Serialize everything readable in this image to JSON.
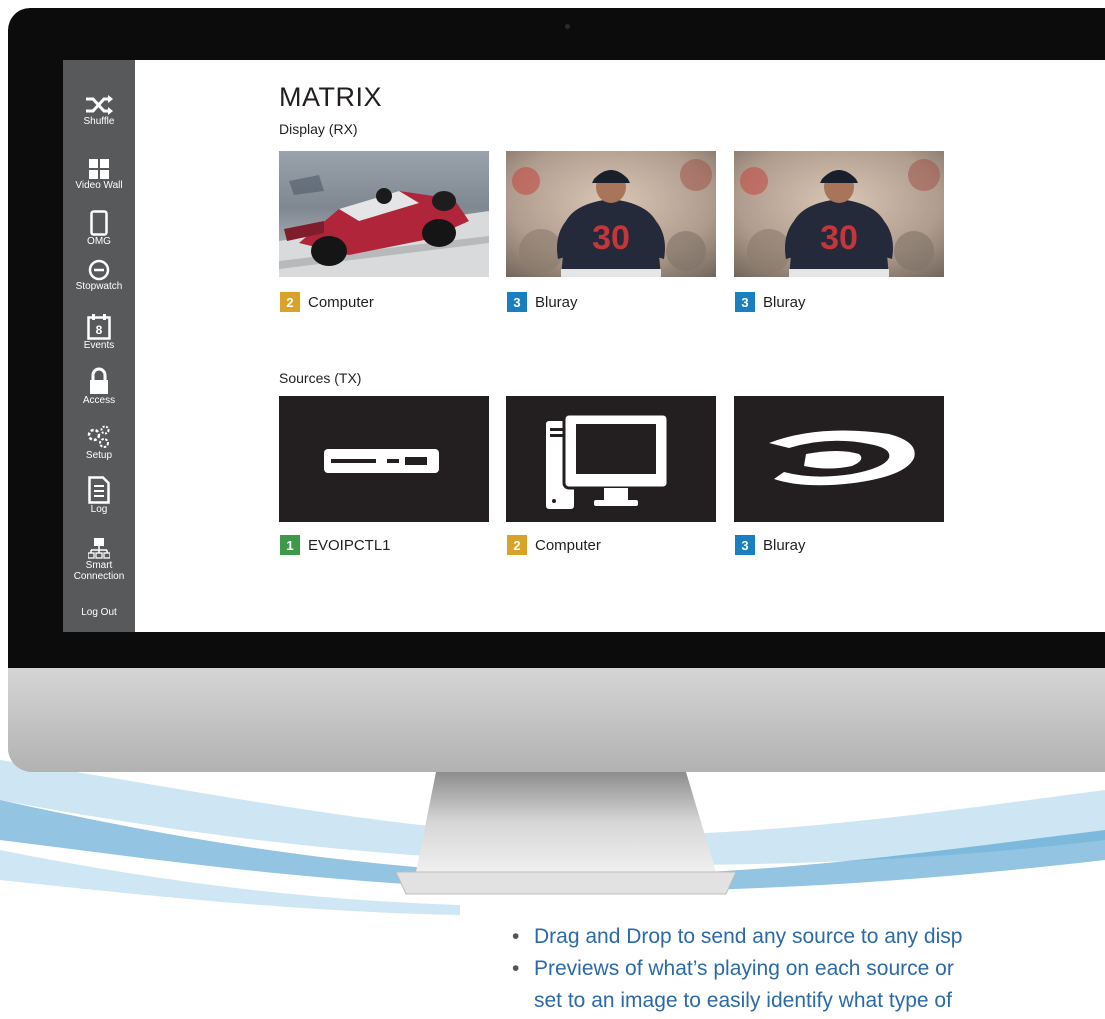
{
  "page": {
    "title": "MATRIX",
    "display_section_label": "Display (RX)",
    "sources_section_label": "Sources (TX)"
  },
  "sidebar": {
    "items": [
      {
        "label": "Shuffle",
        "icon": "shuffle-icon"
      },
      {
        "label": "Video Wall",
        "icon": "grid-icon"
      },
      {
        "label": "OMG",
        "icon": "tablet-icon"
      },
      {
        "label": "Stopwatch",
        "icon": "clock-icon"
      },
      {
        "label": "Events",
        "icon": "calendar-icon",
        "calendar_day": "8"
      },
      {
        "label": "Access",
        "icon": "lock-icon"
      },
      {
        "label": "Setup",
        "icon": "gears-icon"
      },
      {
        "label": "Log",
        "icon": "document-list-icon"
      },
      {
        "label": "Smart Connection",
        "icon": "network-icon"
      },
      {
        "label": "Log Out"
      }
    ]
  },
  "displays": [
    {
      "number": "2",
      "name": "Computer",
      "color": "#d9a32a",
      "preview": "race-car-image"
    },
    {
      "number": "3",
      "name": "Bluray",
      "color": "#1a7fc1",
      "preview": "baseball-player-image",
      "jersey_number": "30"
    },
    {
      "number": "3",
      "name": "Bluray",
      "color": "#1a7fc1",
      "preview": "baseball-player-image",
      "jersey_number": "30"
    }
  ],
  "sources": [
    {
      "number": "1",
      "name": "EVOIPCTL1",
      "color": "#3e9a48",
      "icon": "set-top-box-icon"
    },
    {
      "number": "2",
      "name": "Computer",
      "color": "#d9a32a",
      "icon": "desktop-computer-icon"
    },
    {
      "number": "3",
      "name": "Bluray",
      "color": "#1a7fc1",
      "icon": "bluray-disc-icon"
    }
  ],
  "bullets": [
    "Drag and Drop to send any source to any disp",
    "Previews of what’s playing on each source or",
    "set to an image to easily identify what type of"
  ],
  "colors": {
    "sidebar_bg": "#58595b",
    "tile_bg": "#231f20",
    "bullet_text": "#2b6aa6"
  }
}
